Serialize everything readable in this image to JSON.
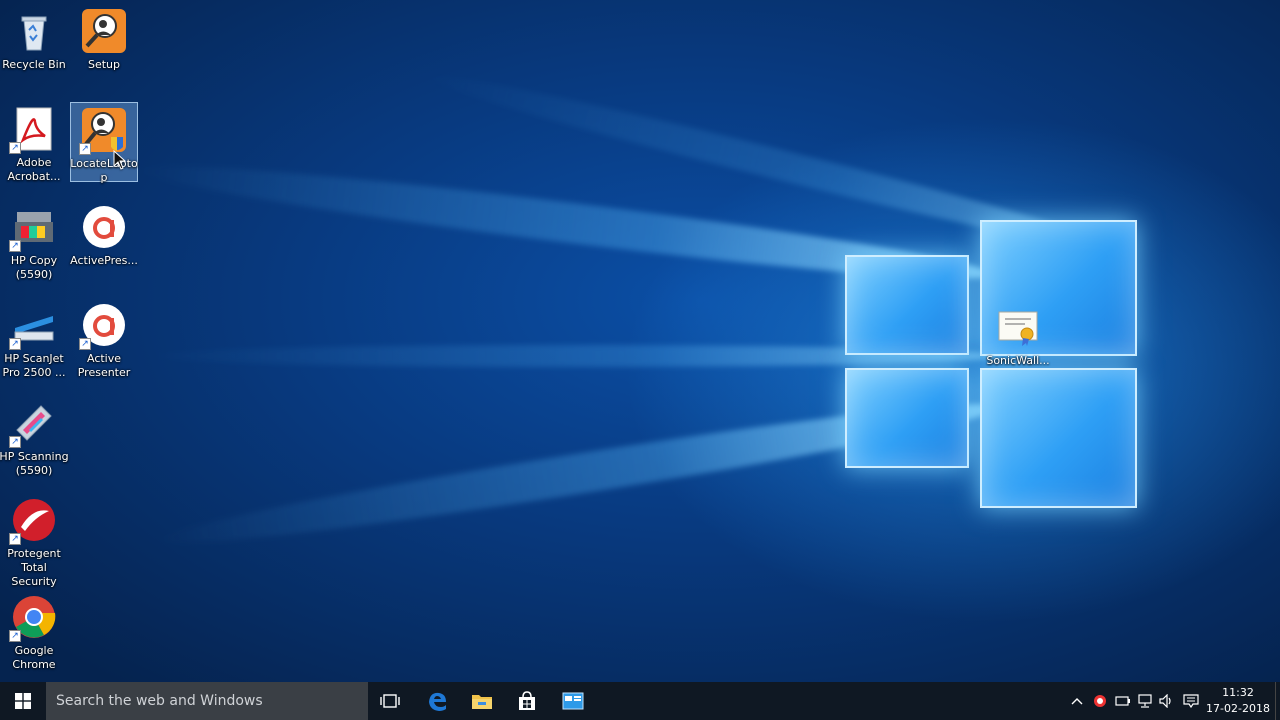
{
  "desktop": {
    "icons": [
      {
        "label": "Recycle Bin",
        "icon": "recycle-bin-icon"
      },
      {
        "label": "Setup",
        "icon": "setup-icon"
      },
      {
        "label": "Adobe Acrobat...",
        "icon": "adobe-acrobat-icon"
      },
      {
        "label": "LocateLaptop",
        "icon": "locatelaptop-icon"
      },
      {
        "label": "HP Copy (5590)",
        "icon": "hp-copy-icon"
      },
      {
        "label": "ActivePres...",
        "icon": "activepresenter-icon"
      },
      {
        "label": "HP ScanJet Pro 2500 ...",
        "icon": "hp-scanjet-icon"
      },
      {
        "label": "Active Presenter",
        "icon": "active-presenter-icon"
      },
      {
        "label": "HP Scanning (5590)",
        "icon": "hp-scanning-icon"
      },
      {
        "label": "Protegent Total Security",
        "icon": "protegent-icon"
      },
      {
        "label": "Google Chrome",
        "icon": "google-chrome-icon"
      },
      {
        "label": "SonicWall...",
        "icon": "sonicwall-certificate-icon"
      }
    ]
  },
  "taskbar": {
    "search_placeholder": "Search the web and Windows",
    "clock_time": "11:32",
    "clock_date": "17-02-2018",
    "apps": [
      "task-view-icon",
      "edge-icon",
      "file-explorer-icon",
      "store-icon",
      "app-window-icon"
    ]
  },
  "colors": {
    "taskbar": "#0f1823",
    "search_box": "#3a3f45",
    "accent": "#1e90ff"
  }
}
